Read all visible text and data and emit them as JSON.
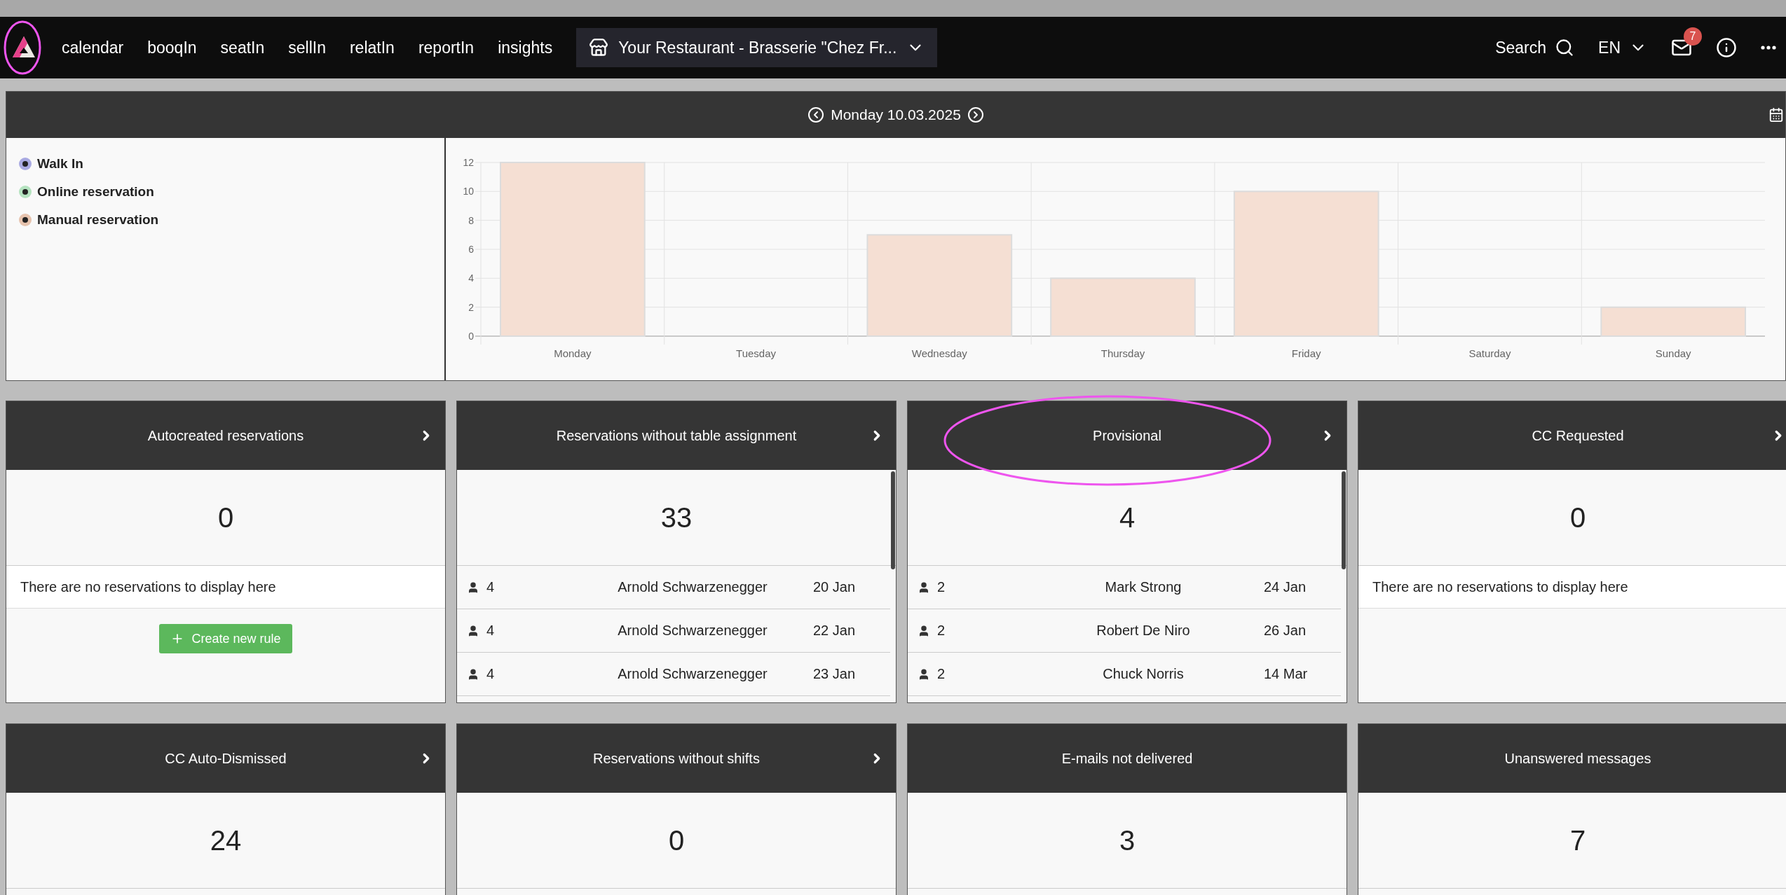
{
  "navbar": {
    "logo": {
      "highlighted": true
    },
    "items": [
      "calendar",
      "booqIn",
      "seatIn",
      "sellIn",
      "relatIn",
      "reportIn",
      "insights"
    ],
    "restaurant": "Your Restaurant - Brasserie \"Chez Fr...",
    "search": "Search",
    "language": "EN",
    "unread_badge": "7"
  },
  "date_bar": {
    "date": "Monday 10.03.2025"
  },
  "legend": [
    {
      "label": "Walk In",
      "color": "#a9aae2"
    },
    {
      "label": "Online reservation",
      "color": "#b5e3c0"
    },
    {
      "label": "Manual reservation",
      "color": "#e6c3ae"
    }
  ],
  "chart": {
    "chart_data": {
      "type": "bar",
      "categories": [
        "Monday",
        "Tuesday",
        "Wednesday",
        "Thursday",
        "Friday",
        "Saturday",
        "Sunday"
      ],
      "values": [
        12,
        0,
        7,
        4,
        10,
        0,
        2
      ],
      "ylim": [
        0,
        12
      ],
      "grid": true,
      "yticks": [
        0,
        2,
        4,
        6,
        8,
        10,
        12
      ]
    }
  },
  "cards": [
    {
      "title": "Autocreated reservations",
      "arrow": true,
      "highlighted": false,
      "count": "0",
      "empty_message": "There are no reservations to display here",
      "button": "Create new rule"
    },
    {
      "title": "Reservations without table assignment",
      "arrow": true,
      "highlighted": false,
      "count": "33",
      "rows": [
        {
          "guests": "4",
          "name": "Arnold Schwarzenegger",
          "date": "20 Jan"
        },
        {
          "guests": "4",
          "name": "Arnold Schwarzenegger",
          "date": "22 Jan"
        },
        {
          "guests": "4",
          "name": "Arnold Schwarzenegger",
          "date": "23 Jan"
        }
      ]
    },
    {
      "title": "Provisional",
      "arrow": true,
      "highlighted": true,
      "count": "4",
      "rows": [
        {
          "guests": "2",
          "name": "Mark Strong",
          "date": "24 Jan"
        },
        {
          "guests": "2",
          "name": "Robert De Niro",
          "date": "26 Jan"
        },
        {
          "guests": "2",
          "name": "Chuck Norris",
          "date": "14 Mar"
        }
      ]
    },
    {
      "title": "CC Requested",
      "arrow": true,
      "highlighted": false,
      "count": "0",
      "empty_message": "There are no reservations to display here"
    },
    {
      "title": "CC Auto-Dismissed",
      "arrow": true,
      "highlighted": false,
      "count": "24"
    },
    {
      "title": "Reservations without shifts",
      "arrow": true,
      "highlighted": false,
      "count": "0"
    },
    {
      "title": "E-mails not delivered",
      "arrow": false,
      "highlighted": false,
      "count": "3"
    },
    {
      "title": "Unanswered messages",
      "arrow": false,
      "highlighted": false,
      "count": "7"
    }
  ]
}
